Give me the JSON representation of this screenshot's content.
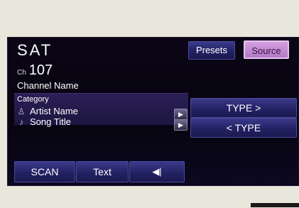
{
  "source_label": "SAT",
  "channel": {
    "prefix": "Ch",
    "number": "107"
  },
  "channel_name": "Channel Name",
  "info": {
    "category": "Category",
    "artist": "Artist Name",
    "song": "Song Title"
  },
  "buttons": {
    "presets": "Presets",
    "source": "Source",
    "type_next": "TYPE >",
    "type_prev": "< TYPE",
    "scan": "SCAN",
    "text": "Text",
    "scroll_glyph": "▶",
    "mute_glyph": "◀|"
  },
  "icons": {
    "artist": "person-icon",
    "song": "music-note-icon"
  },
  "colors": {
    "accent": "#b27bc4",
    "button": "#232264",
    "panel": "#2b1f55"
  }
}
